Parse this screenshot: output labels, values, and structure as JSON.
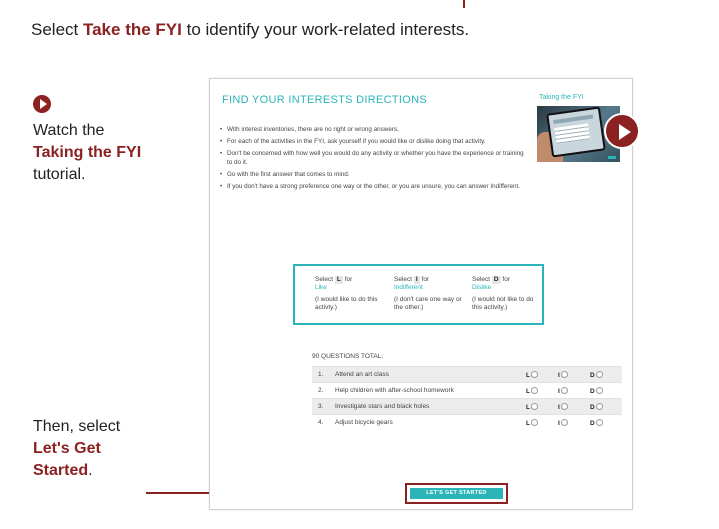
{
  "intro": {
    "prefix": "Select ",
    "emphasis": "Take the FYI",
    "suffix": " to identify your work-related interests."
  },
  "watch": {
    "prefix": "Watch the",
    "emphasis": "Taking the FYI",
    "suffix": " tutorial."
  },
  "then": {
    "prefix": "Then, select",
    "emphasis": "Let's Get Started",
    "suffix": "."
  },
  "screen": {
    "title": "FIND YOUR INTERESTS DIRECTIONS",
    "bullets": [
      "With interest inventories, there are no right or wrong answers.",
      "For each of the activities in the FYI, ask yourself if you would like or dislike doing that activity.",
      "Don't be concerned with how well you would do any activity or whether you have the experience or training to do it.",
      "Go with the first answer that comes to mind.",
      "If you don't have a strong preference one way or the other, or you are unsure, you can answer Indifferent."
    ],
    "video_label": "Taking the FYI",
    "legend": [
      {
        "select": "Select",
        "key": "L",
        "for": "for",
        "word": "Like",
        "desc": "(I would like to do this activty.)"
      },
      {
        "select": "Select",
        "key": "I",
        "for": "for",
        "word": "Indifferent",
        "desc": "(I don't care one way or the other.)"
      },
      {
        "select": "Select",
        "key": "D",
        "for": "for",
        "word": "Dislike",
        "desc": "(I would not like to do this activity.)"
      }
    ],
    "questions_total": "90 QUESTIONS TOTAL:",
    "questions": [
      {
        "num": "1.",
        "text": "Attend an art class"
      },
      {
        "num": "2.",
        "text": "Help children with after-school homework"
      },
      {
        "num": "3.",
        "text": "Investigate stars and black holes"
      },
      {
        "num": "4.",
        "text": "Adjust bicycle gears"
      }
    ],
    "options": [
      "L",
      "I",
      "D"
    ],
    "start_button": "LET'S GET STARTED"
  },
  "colors": {
    "accent": "#8b2121",
    "teal": "#2bb5b9"
  },
  "icons": {
    "bullet": "play-circle-icon",
    "video": "play-circle-icon"
  }
}
